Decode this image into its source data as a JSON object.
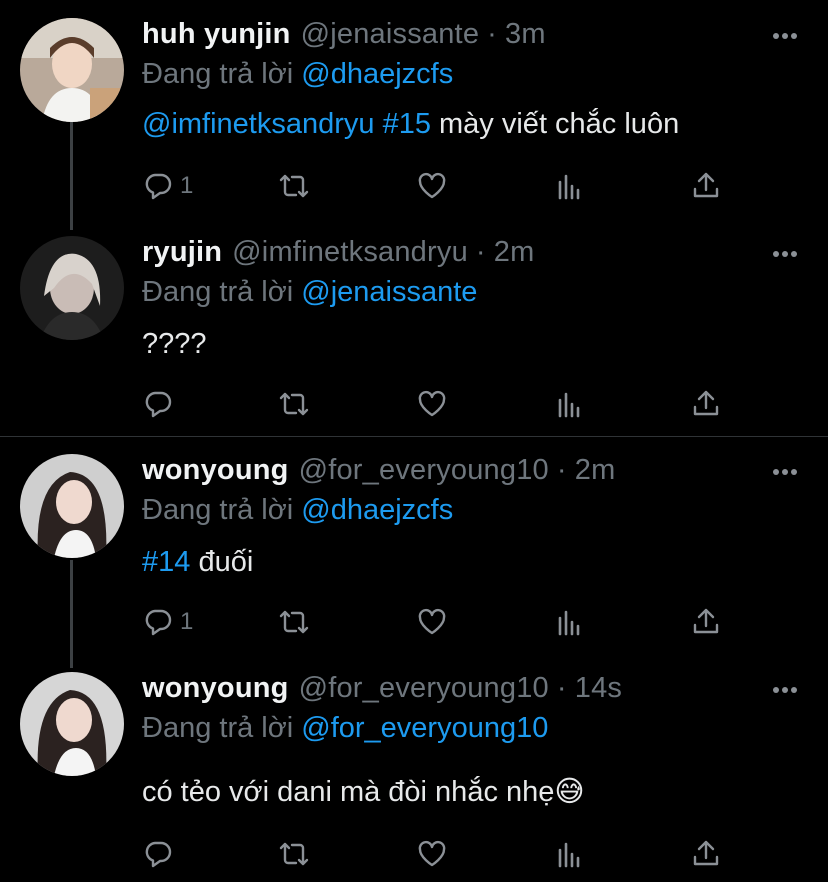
{
  "colors": {
    "background": "#000000",
    "link": "#1d9bf0",
    "muted": "#6e767d",
    "text": "#e7e9ea"
  },
  "reply_prefix": "Đang trả lời",
  "tweets": [
    {
      "name": "huh yunjin",
      "handle": "@jenaissante",
      "time": "3m",
      "reply_to": "@dhaejzcfs",
      "body_link": "@imfinetksandryu #15",
      "body_text": " mày viết chắc luôn",
      "reply_count": "1",
      "avatar_icon": "avatar-photo"
    },
    {
      "name": "ryujin",
      "handle": "@imfinetksandryu",
      "time": "2m",
      "reply_to": "@jenaissante",
      "body_link": "",
      "body_text": "????",
      "reply_count": "",
      "avatar_icon": "avatar-photo"
    },
    {
      "name": "wonyoung",
      "handle": "@for_everyoung10",
      "time": "2m",
      "reply_to": "@dhaejzcfs",
      "body_link": "#14",
      "body_text": " đuối",
      "reply_count": "1",
      "avatar_icon": "avatar-photo"
    },
    {
      "name": "wonyoung",
      "handle": "@for_everyoung10",
      "time": "14s",
      "reply_to": "@for_everyoung10",
      "body_link": "",
      "body_text": "có tẻo với dani mà đòi nhắc nhẹ",
      "body_emoji": "😅",
      "reply_count": "",
      "avatar_icon": "avatar-photo"
    }
  ],
  "icons": [
    "more-icon",
    "reply-icon",
    "retweet-icon",
    "like-icon",
    "analytics-icon",
    "share-icon"
  ]
}
